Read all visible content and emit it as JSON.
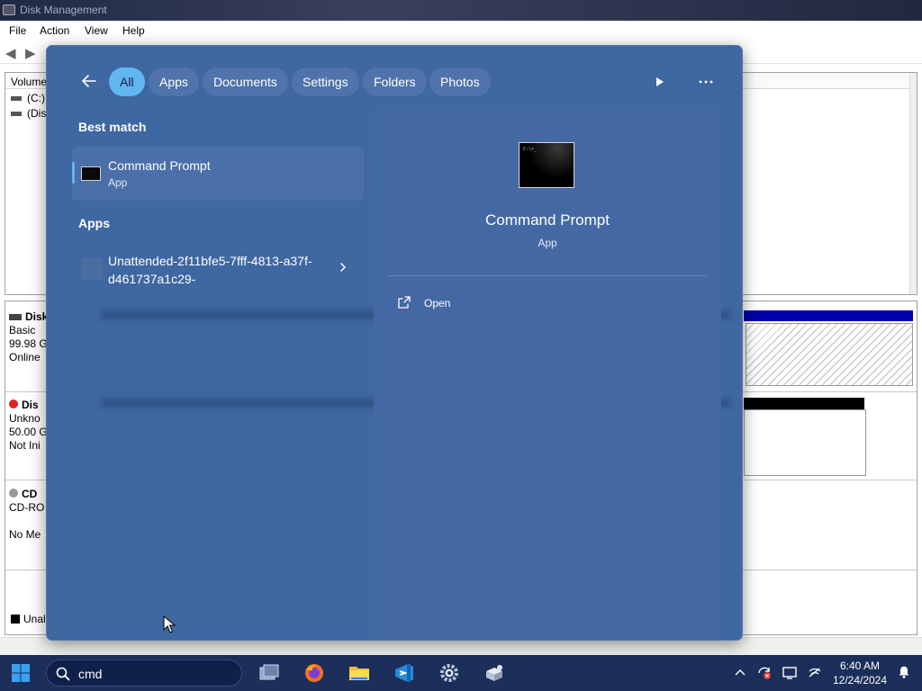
{
  "background_window": {
    "title": "Disk Management",
    "menu": [
      "File",
      "Action",
      "View",
      "Help"
    ],
    "volume_column_header": "Volume",
    "volumes": [
      "(C:)",
      "(Disk"
    ],
    "disks": [
      {
        "name": "Disk",
        "lines": [
          "Basic",
          "99.98 G",
          "Online"
        ]
      },
      {
        "name": "Dis",
        "lines": [
          "Unkno",
          "50.00 G",
          "Not Ini"
        ]
      },
      {
        "name": "CD",
        "lines": [
          "CD-RO",
          "",
          "No Me"
        ]
      }
    ],
    "legend": "Unal"
  },
  "search_flyout": {
    "filters": [
      "All",
      "Apps",
      "Documents",
      "Settings",
      "Folders",
      "Photos"
    ],
    "active_filter": "All",
    "best_match_heading": "Best match",
    "best_match": {
      "name": "Command Prompt",
      "type": "App"
    },
    "apps_heading": "Apps",
    "apps": [
      {
        "name": "Unattended-2f11bfe5-7fff-4813-a37f-d461737a1c29-"
      }
    ],
    "preview": {
      "name": "Command Prompt",
      "type": "App",
      "actions": [
        {
          "label": "Open",
          "icon": "open-external-icon"
        }
      ]
    }
  },
  "taskbar": {
    "search_text": "cmd",
    "pinned_icons": [
      "task-view-icon",
      "firefox-icon",
      "file-explorer-icon",
      "vscode-icon",
      "settings-icon",
      "package-installer-icon"
    ],
    "tray_icons": [
      "chevron-up-icon",
      "sync-error-icon",
      "display-icon",
      "network-icon"
    ],
    "clock": {
      "time": "6:40 AM",
      "date": "12/24/2024"
    }
  },
  "colors": {
    "flyout_bg": "#3f67a2",
    "accent": "#61b6f0",
    "taskbar_bg": "#1b2f5a"
  }
}
